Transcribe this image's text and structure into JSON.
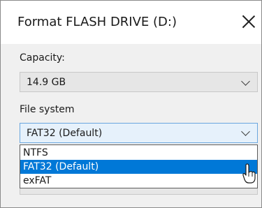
{
  "window": {
    "title": "Format FLASH DRIVE (D:)"
  },
  "capacity": {
    "label": "Capacity:",
    "value": "14.9 GB"
  },
  "file_system": {
    "label": "File system",
    "selected": "FAT32 (Default)",
    "options": [
      "NTFS",
      "FAT32 (Default)",
      "exFAT"
    ],
    "highlighted_option": "FAT32 (Default)"
  },
  "colors": {
    "selection": "#0078d7",
    "focused_combo_bg": "#e6f1fb",
    "focused_combo_border": "#6aa6de",
    "dialog_bg": "#f0f0f0"
  }
}
